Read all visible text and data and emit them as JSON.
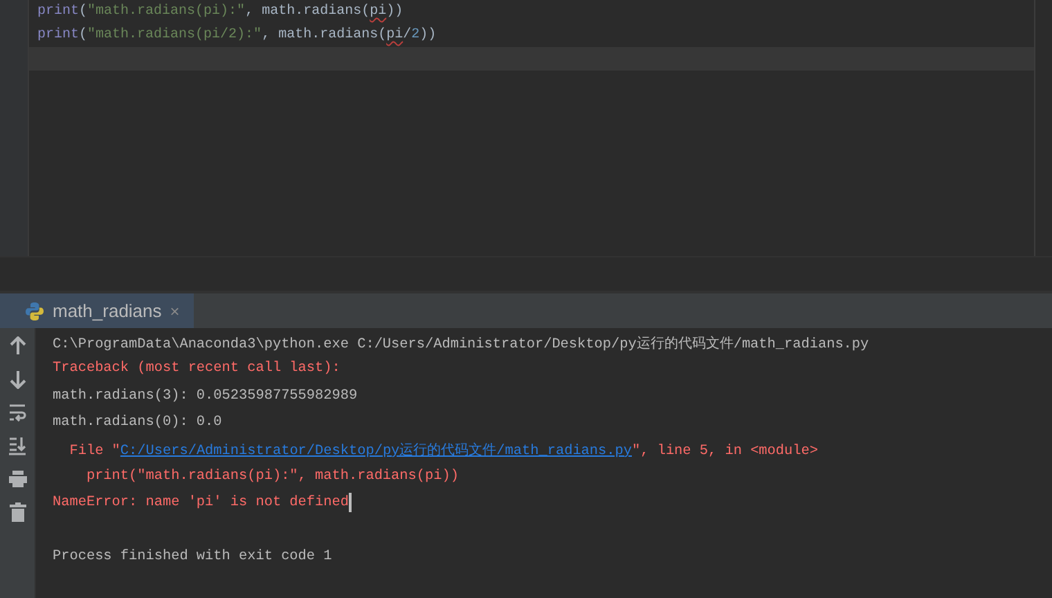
{
  "editor": {
    "lines": [
      {
        "current": false,
        "segments": [
          {
            "kind": "builtin",
            "text": "print"
          },
          {
            "kind": "plain",
            "text": "("
          },
          {
            "kind": "string",
            "text": "\"math.radians(pi):\""
          },
          {
            "kind": "plain",
            "text": ", math.radians("
          },
          {
            "kind": "flagged",
            "text": "pi"
          },
          {
            "kind": "plain",
            "text": "))"
          }
        ]
      },
      {
        "current": false,
        "segments": [
          {
            "kind": "builtin",
            "text": "print"
          },
          {
            "kind": "plain",
            "text": "("
          },
          {
            "kind": "string",
            "text": "\"math.radians(pi/2):\""
          },
          {
            "kind": "plain",
            "text": ", math.radians("
          },
          {
            "kind": "flagged",
            "text": "pi"
          },
          {
            "kind": "plain",
            "text": "/"
          },
          {
            "kind": "number",
            "text": "2"
          },
          {
            "kind": "plain",
            "text": "))"
          }
        ]
      },
      {
        "current": true
      }
    ]
  },
  "run_tab": {
    "label": "math_radians",
    "close": "×",
    "selected": true
  },
  "console": {
    "lines": [
      {
        "cursor": false,
        "segments": [
          {
            "kind": "output",
            "text": "C:\\ProgramData\\Anaconda3\\python.exe C:/Users/Administrator/Desktop/py运行的代码文件/math_radians.py"
          }
        ]
      },
      {
        "cursor": false,
        "segments": [
          {
            "kind": "error",
            "text": "Traceback (most recent call last):"
          }
        ]
      },
      {
        "cursor": false,
        "segments": [
          {
            "kind": "output",
            "text": "math.radians(3): 0.05235987755982989"
          }
        ]
      },
      {
        "cursor": false,
        "segments": [
          {
            "kind": "output",
            "text": "math.radians(0): 0.0"
          }
        ]
      },
      {
        "cursor": false,
        "segments": [
          {
            "kind": "error",
            "text": "  File \""
          },
          {
            "kind": "link",
            "text": "C:/Users/Administrator/Desktop/py运行的代码文件/math_radians.py"
          },
          {
            "kind": "error",
            "text": "\", line 5, in <module>"
          }
        ]
      },
      {
        "cursor": false,
        "segments": [
          {
            "kind": "error",
            "text": "    print(\"math.radians(pi):\", math.radians(pi))"
          }
        ]
      },
      {
        "cursor": true,
        "segments": [
          {
            "kind": "error",
            "text": "NameError: name 'pi' is not defined"
          }
        ]
      },
      {
        "cursor": false
      },
      {
        "cursor": false,
        "segments": [
          {
            "kind": "output",
            "text": "Process finished with exit code 1"
          }
        ]
      }
    ]
  }
}
